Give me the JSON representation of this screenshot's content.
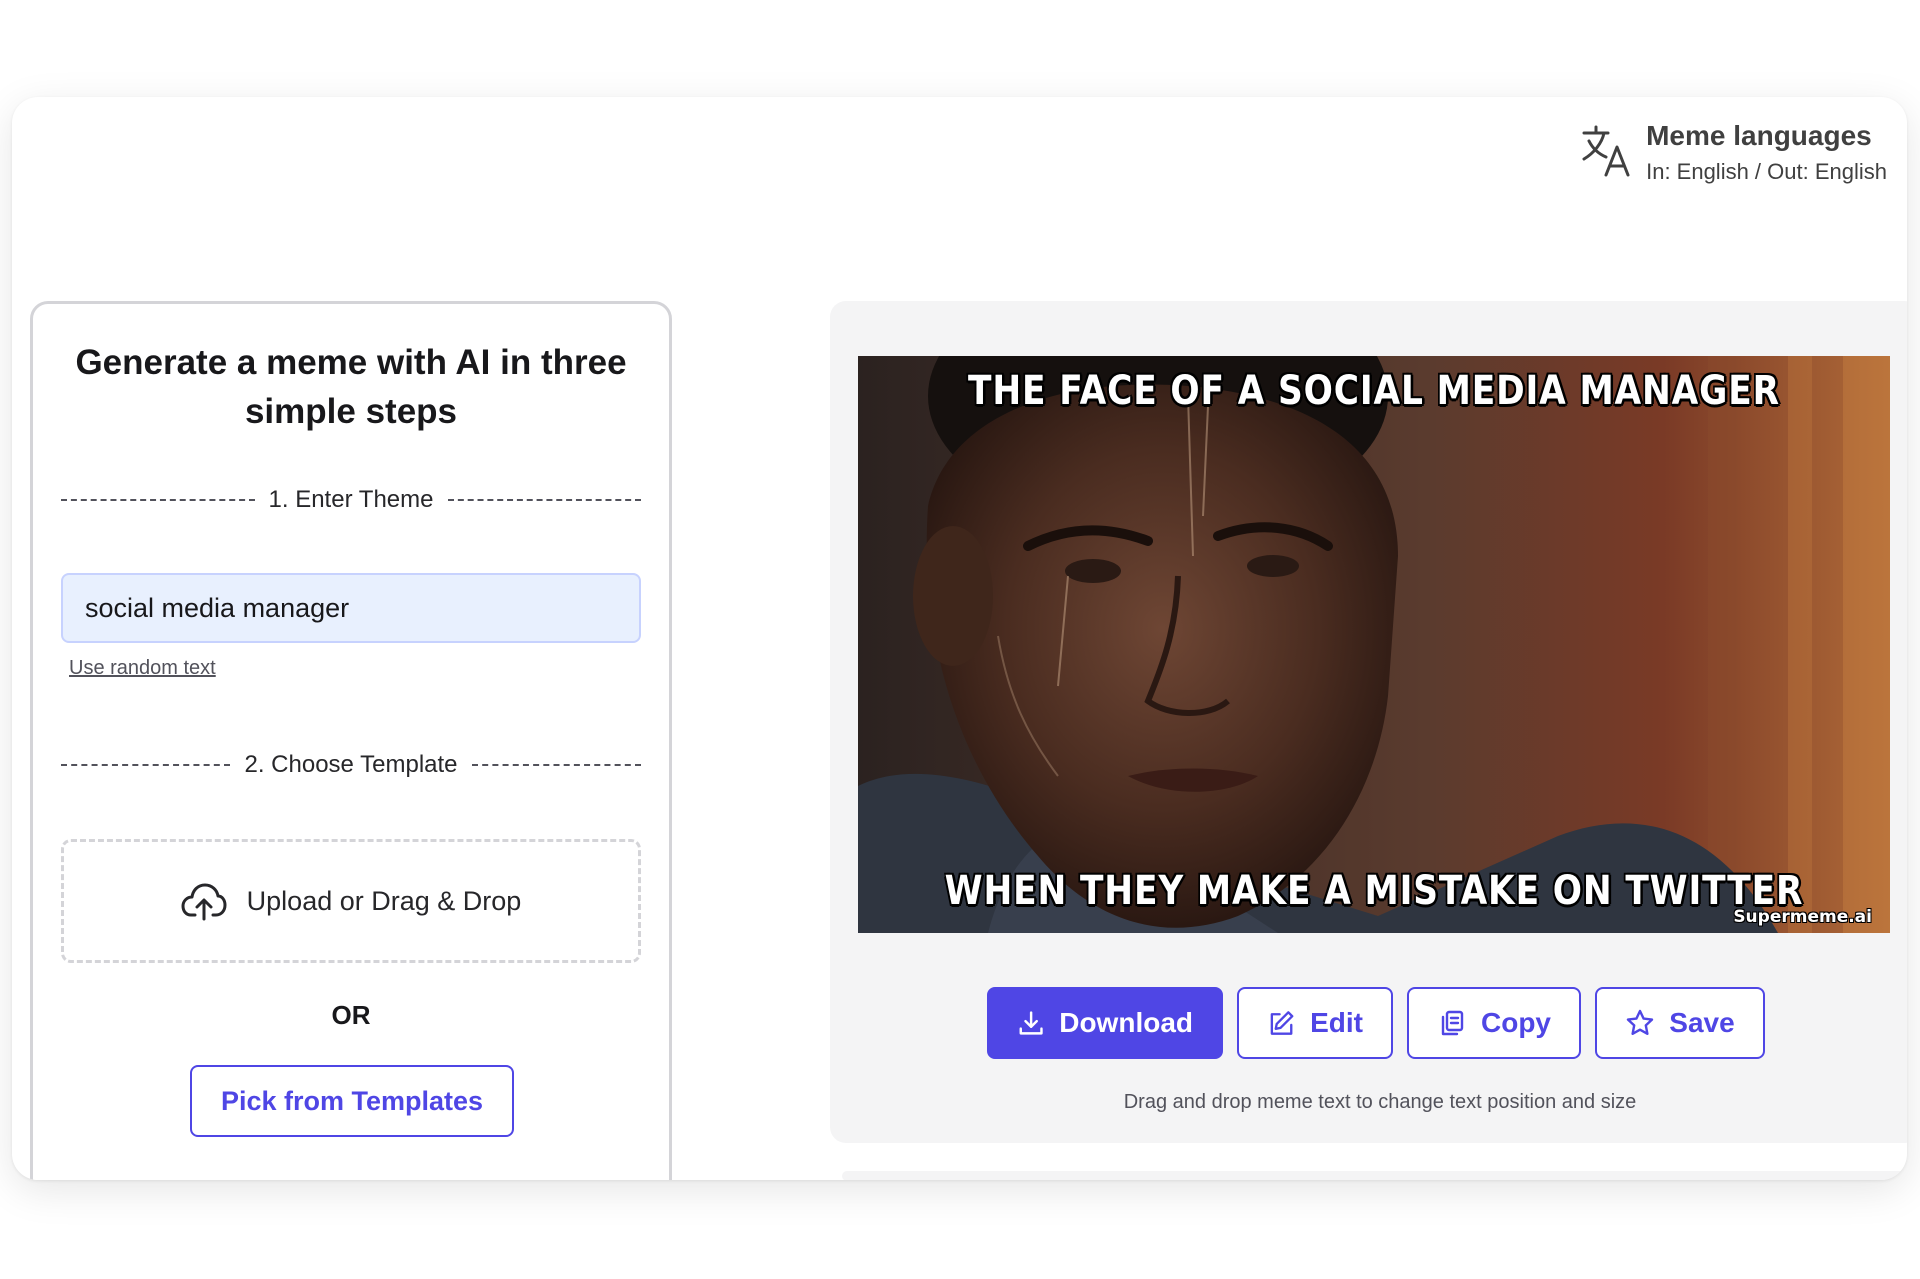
{
  "language": {
    "title": "Meme languages",
    "subtitle": "In: English / Out: English"
  },
  "left_panel": {
    "heading": "Generate a meme with AI in three simple steps",
    "step1_label": "1. Enter Theme",
    "theme_value": "social media manager",
    "random_link": "Use random text",
    "step2_label": "2. Choose Template",
    "upload_label": "Upload or Drag & Drop",
    "or_label": "OR",
    "pick_label": "Pick from Templates"
  },
  "meme": {
    "top_text": "THE FACE OF A SOCIAL MEDIA MANAGER",
    "bottom_text": "WHEN THEY MAKE A MISTAKE ON TWITTER",
    "watermark": "Supermeme.ai"
  },
  "actions": {
    "download": "Download",
    "edit": "Edit",
    "copy": "Copy",
    "save": "Save"
  },
  "hint": "Drag and drop meme text to change text position and size",
  "colors": {
    "accent": "#4f46e5",
    "input_bg": "#e8f0fe",
    "panel_bg": "#f4f4f5"
  }
}
